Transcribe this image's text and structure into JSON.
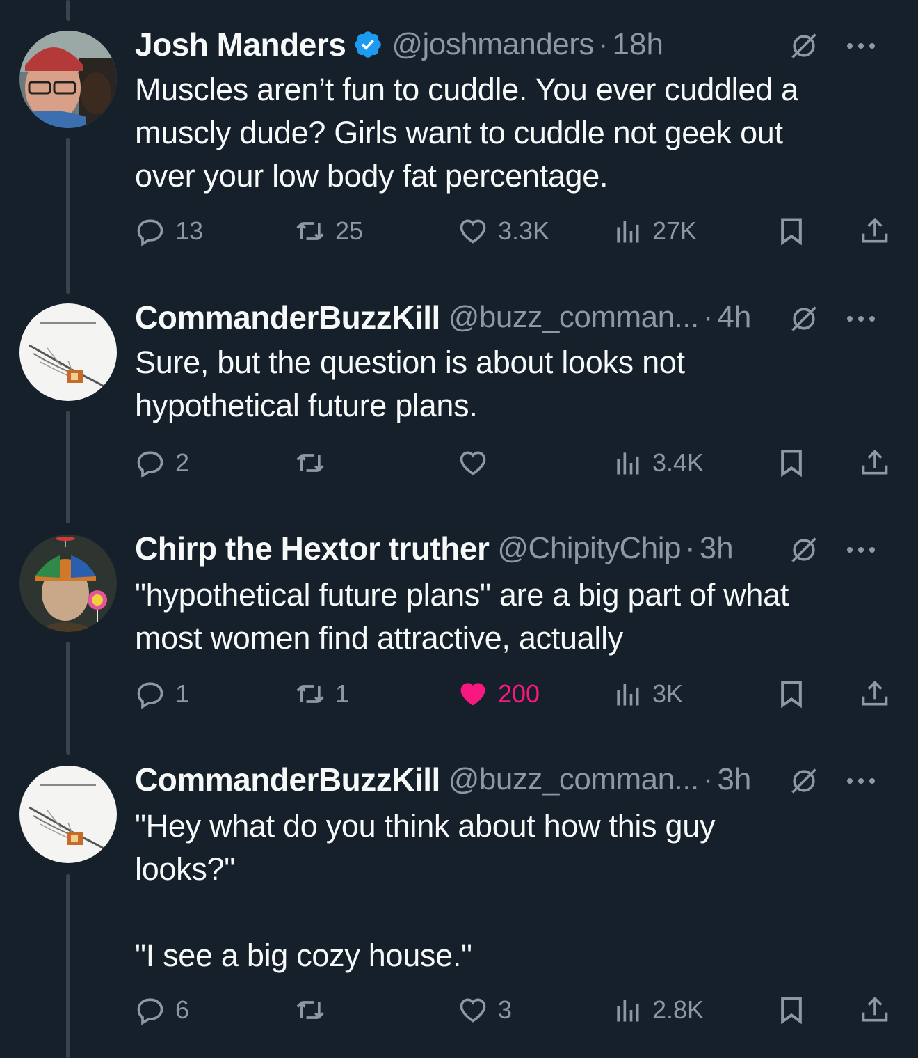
{
  "tweets": [
    {
      "name": "Josh Manders",
      "verified": true,
      "handle": "@joshmanders",
      "time": "18h",
      "text": "Muscles aren’t fun to cuddle. You ever cuddled a\nmuscly dude? Girls want to cuddle not geek out\nover your low body fat percentage.",
      "replies": "13",
      "retweets": "25",
      "likes": "3.3K",
      "views": "27K",
      "liked": false
    },
    {
      "name": "CommanderBuzzKill",
      "verified": false,
      "handle": "@buzz_comman...",
      "time": "4h",
      "text": "Sure, but the question is about looks not\nhypothetical future plans.",
      "replies": "2",
      "retweets": "",
      "likes": "",
      "views": "3.4K",
      "liked": false
    },
    {
      "name": "Chirp the Hextor truther",
      "verified": false,
      "handle": "@ChipityChip",
      "time": "3h",
      "text": "\"hypothetical future plans\" are a big part of what\nmost women find attractive, actually",
      "replies": "1",
      "retweets": "1",
      "likes": "200",
      "views": "3K",
      "liked": true
    },
    {
      "name": "CommanderBuzzKill",
      "verified": false,
      "handle": "@buzz_comman...",
      "time": "3h",
      "text": "\"Hey what do you think about how this guy\nlooks?\"\n\n\"I see a big cozy house.\"",
      "replies": "6",
      "retweets": "",
      "likes": "3",
      "views": "2.8K",
      "liked": false
    }
  ],
  "colors": {
    "background": "#15202b",
    "secondary_text": "#8b98a5",
    "like_active": "#f91880",
    "verified": "#1d9bf0",
    "thread_line": "#38444d"
  },
  "icons": {
    "reply": "reply-icon",
    "retweet": "retweet-icon",
    "like": "heart-icon",
    "views": "views-icon",
    "bookmark": "bookmark-icon",
    "share": "share-icon",
    "grok": "grok-icon",
    "more": "more-icon"
  }
}
